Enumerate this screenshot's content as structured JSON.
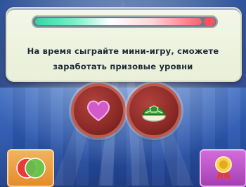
{
  "progress": {
    "level": 0.93
  },
  "message": {
    "line1": "На время сыграйте мини-игру, сможете",
    "line2": "заработать призовые уровни"
  },
  "buttons": {
    "heart": "heart-icon",
    "shell": "green-shell-icon",
    "left": "two-player-icon",
    "right": "award-ribbon-icon"
  },
  "colors": {
    "panel": "#eef2e1",
    "bar_start": "#2fd7a6",
    "bar_end": "#ff5f6d",
    "round_button": "#8c2a27",
    "left_button": "#e48c2a",
    "right_button": "#a540b3"
  }
}
